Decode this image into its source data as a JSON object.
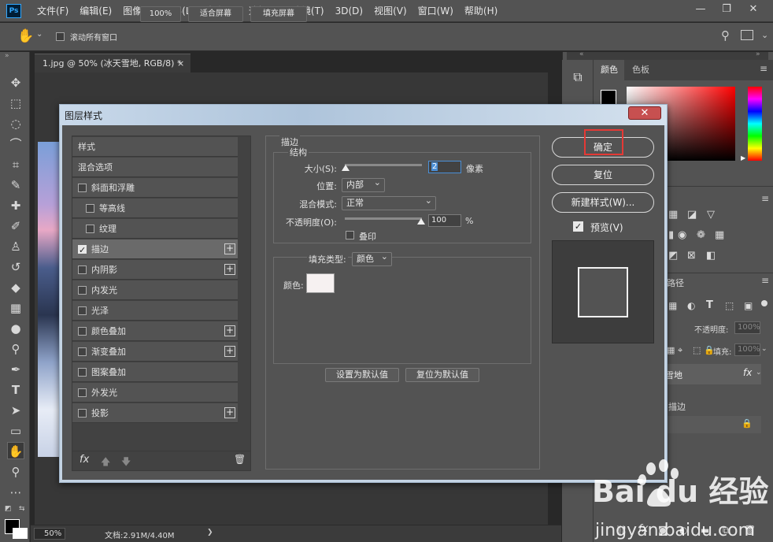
{
  "menubar": {
    "logo": "Ps",
    "items": [
      "文件(F)",
      "编辑(E)",
      "图像(I)",
      "图层(L)",
      "文字(Y)",
      "选择(S)",
      "滤镜(T)",
      "3D(D)",
      "视图(V)",
      "窗口(W)",
      "帮助(H)"
    ]
  },
  "options": {
    "scroll_all_label": "滚动所有窗口",
    "zoom": "100%",
    "fit_screen": "适合屏幕",
    "fill_screen": "填充屏幕"
  },
  "document": {
    "tab_title": "1.jpg @ 50% (冰天雪地, RGB/8) *",
    "tab_close": "×",
    "status_zoom": "50%",
    "status_doc": "文档:2.91M/4.40M",
    "status_arrow": "❯"
  },
  "panels": {
    "color_tabs": [
      "颜色",
      "色板"
    ],
    "opacity_label": "不透明度:",
    "opacity_value": "100%",
    "fill_label": "填充:",
    "fill_value": "100%",
    "paths_tab_fragment": "路径",
    "layer_name_fragment": "雪地",
    "effect_fragment": "描边",
    "fx_label": "fx"
  },
  "dialog": {
    "title": "图层样式",
    "close": "✕",
    "styles": [
      {
        "label": "样式",
        "checkbox": false,
        "plus": false,
        "checked": false,
        "indent": 0
      },
      {
        "label": "混合选项",
        "checkbox": false,
        "plus": false,
        "checked": false,
        "indent": 0
      },
      {
        "label": "斜面和浮雕",
        "checkbox": true,
        "plus": false,
        "checked": false,
        "indent": 0
      },
      {
        "label": "等高线",
        "checkbox": true,
        "plus": false,
        "checked": false,
        "indent": 1
      },
      {
        "label": "纹理",
        "checkbox": true,
        "plus": false,
        "checked": false,
        "indent": 1
      },
      {
        "label": "描边",
        "checkbox": true,
        "plus": true,
        "checked": true,
        "indent": 0
      },
      {
        "label": "内阴影",
        "checkbox": true,
        "plus": true,
        "checked": false,
        "indent": 0
      },
      {
        "label": "内发光",
        "checkbox": true,
        "plus": false,
        "checked": false,
        "indent": 0
      },
      {
        "label": "光泽",
        "checkbox": true,
        "plus": false,
        "checked": false,
        "indent": 0
      },
      {
        "label": "颜色叠加",
        "checkbox": true,
        "plus": true,
        "checked": false,
        "indent": 0
      },
      {
        "label": "渐变叠加",
        "checkbox": true,
        "plus": true,
        "checked": false,
        "indent": 0
      },
      {
        "label": "图案叠加",
        "checkbox": true,
        "plus": false,
        "checked": false,
        "indent": 0
      },
      {
        "label": "外发光",
        "checkbox": true,
        "plus": false,
        "checked": false,
        "indent": 0
      },
      {
        "label": "投影",
        "checkbox": true,
        "plus": true,
        "checked": false,
        "indent": 0
      }
    ],
    "fx_label": "fx",
    "stroke": {
      "section_title": "描边",
      "structure_title": "结构",
      "size_label": "大小(S):",
      "size_value": "2",
      "size_unit": "像素",
      "position_label": "位置:",
      "position_value": "内部",
      "blend_label": "混合模式:",
      "blend_value": "正常",
      "opacity_label": "不透明度(O):",
      "opacity_value": "100",
      "opacity_unit": "%",
      "overprint_label": "叠印",
      "fill_type_label": "填充类型:",
      "fill_type_value": "颜色",
      "color_label": "颜色:",
      "color_value": "#f6f1f1",
      "set_default": "设置为默认值",
      "reset_default": "复位为默认值"
    },
    "buttons": {
      "ok": "确定",
      "reset": "复位",
      "new_style": "新建样式(W)...",
      "preview_label": "预览(V)"
    }
  },
  "watermark": {
    "text": "Bai du 经验",
    "url": "jingyan.baidu.com"
  }
}
